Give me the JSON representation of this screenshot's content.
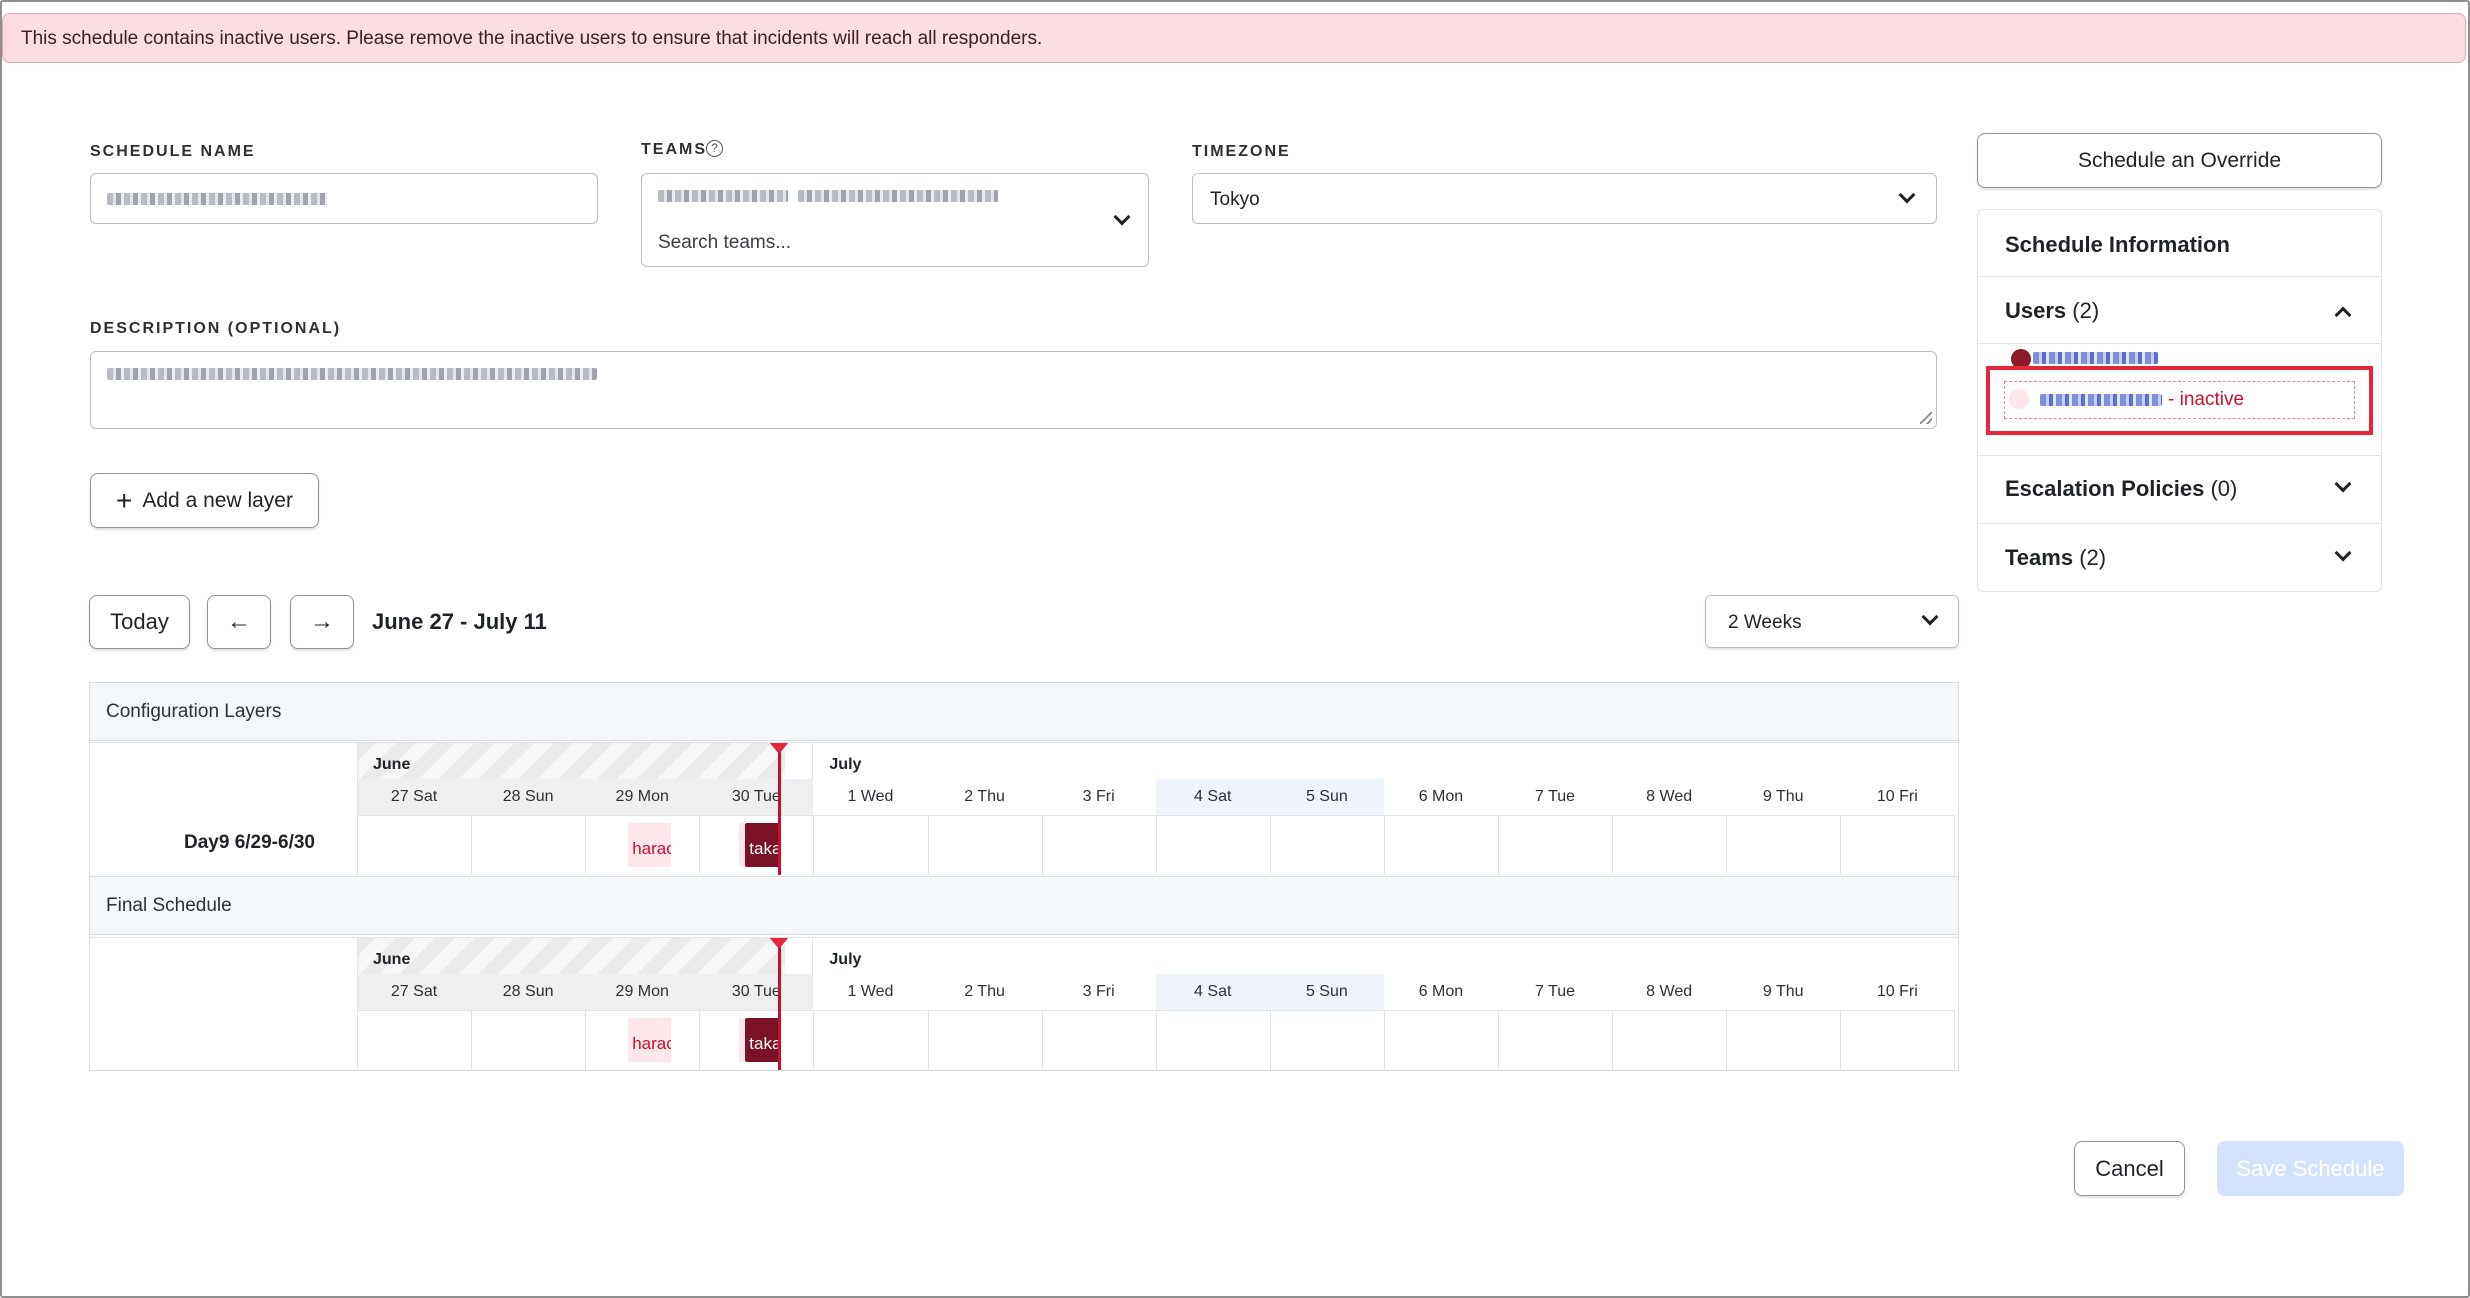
{
  "banner": {
    "text": "This schedule contains inactive users. Please remove the inactive users to ensure that incidents will reach all responders."
  },
  "form": {
    "schedule_name_label": "SCHEDULE NAME",
    "teams_label": "TEAMS",
    "teams_placeholder": "Search teams...",
    "timezone_label": "TIMEZONE",
    "timezone_value": "Tokyo",
    "description_label": "DESCRIPTION (OPTIONAL)",
    "add_layer_label": "Add a new layer"
  },
  "nav": {
    "today": "Today",
    "date_range": "June 27 - July 11",
    "range_select": "2 Weeks"
  },
  "calendar": {
    "config_title": "Configuration Layers",
    "final_title": "Final Schedule",
    "layer_name": "Day9 6/29-6/30",
    "month_june": "June",
    "month_july": "July",
    "days": [
      "27 Sat",
      "28 Sun",
      "29 Mon",
      "30 Tue",
      "1 Wed",
      "2 Thu",
      "3 Fri",
      "4 Sat",
      "5 Sun",
      "6 Mon",
      "7 Tue",
      "8 Wed",
      "9 Thu",
      "10 Fri"
    ],
    "shift_a": "harac",
    "shift_b": "taka",
    "shift_b_prefix": "t"
  },
  "sidebar": {
    "override_button": "Schedule an Override",
    "info_title": "Schedule Information",
    "users_title": "Users",
    "users_count": "(2)",
    "inactive_suffix": "- inactive",
    "escalation_title": "Escalation Policies",
    "escalation_count": "(0)",
    "teams_title": "Teams",
    "teams_count": "(2)"
  },
  "footer": {
    "cancel": "Cancel",
    "save": "Save Schedule"
  },
  "colors": {
    "banner_bg": "#fcdde1",
    "accent_red": "#c8102e",
    "shift_dark": "#7a1126",
    "shift_light": "#fde7ea",
    "save_disabled": "#d4e1fb"
  }
}
